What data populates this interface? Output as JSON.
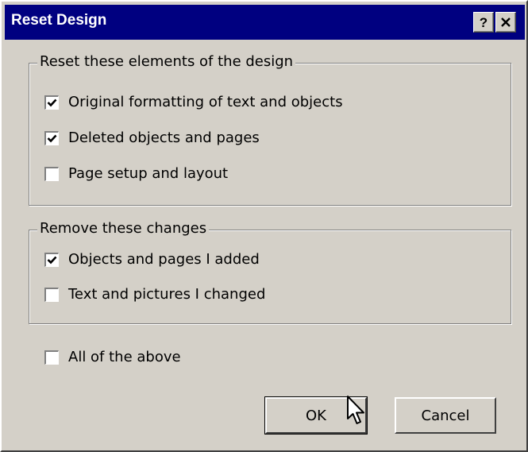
{
  "dialog": {
    "title": "Reset Design",
    "help_button": "?",
    "close_button": "✕"
  },
  "group_reset": {
    "legend": "Reset these elements of the design",
    "items": [
      {
        "label": "Original formatting of text and objects",
        "checked": true
      },
      {
        "label": "Deleted objects and pages",
        "checked": true
      },
      {
        "label": "Page setup and layout",
        "checked": false
      }
    ]
  },
  "group_remove": {
    "legend": "Remove these changes",
    "items": [
      {
        "label": "Objects and pages I added",
        "checked": true
      },
      {
        "label": "Text and pictures I changed",
        "checked": false
      }
    ]
  },
  "all_of_above": {
    "label": "All of the above",
    "checked": false
  },
  "buttons": {
    "ok": "OK",
    "cancel": "Cancel"
  },
  "icons": {
    "cursor": "arrow-cursor-icon",
    "check": "checkmark-icon"
  }
}
